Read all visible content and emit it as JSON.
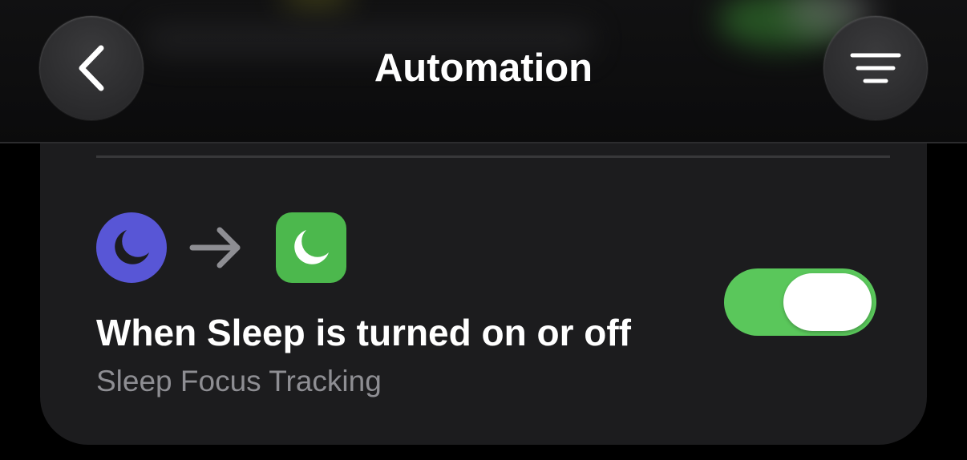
{
  "nav": {
    "title": "Automation",
    "back_icon": "chevron-left-icon",
    "menu_icon": "filter-lines-icon"
  },
  "automation": {
    "trigger_icon": "moon-icon",
    "arrow_icon": "arrow-right-icon",
    "action_icon": "moon-icon",
    "title": "When Sleep is turned on or off",
    "subtitle": "Sleep Focus Tracking",
    "enabled": true
  },
  "colors": {
    "trigger_icon_bg": "#5856d6",
    "action_icon_bg": "#4cb84d",
    "toggle_on": "#5ac75b"
  }
}
